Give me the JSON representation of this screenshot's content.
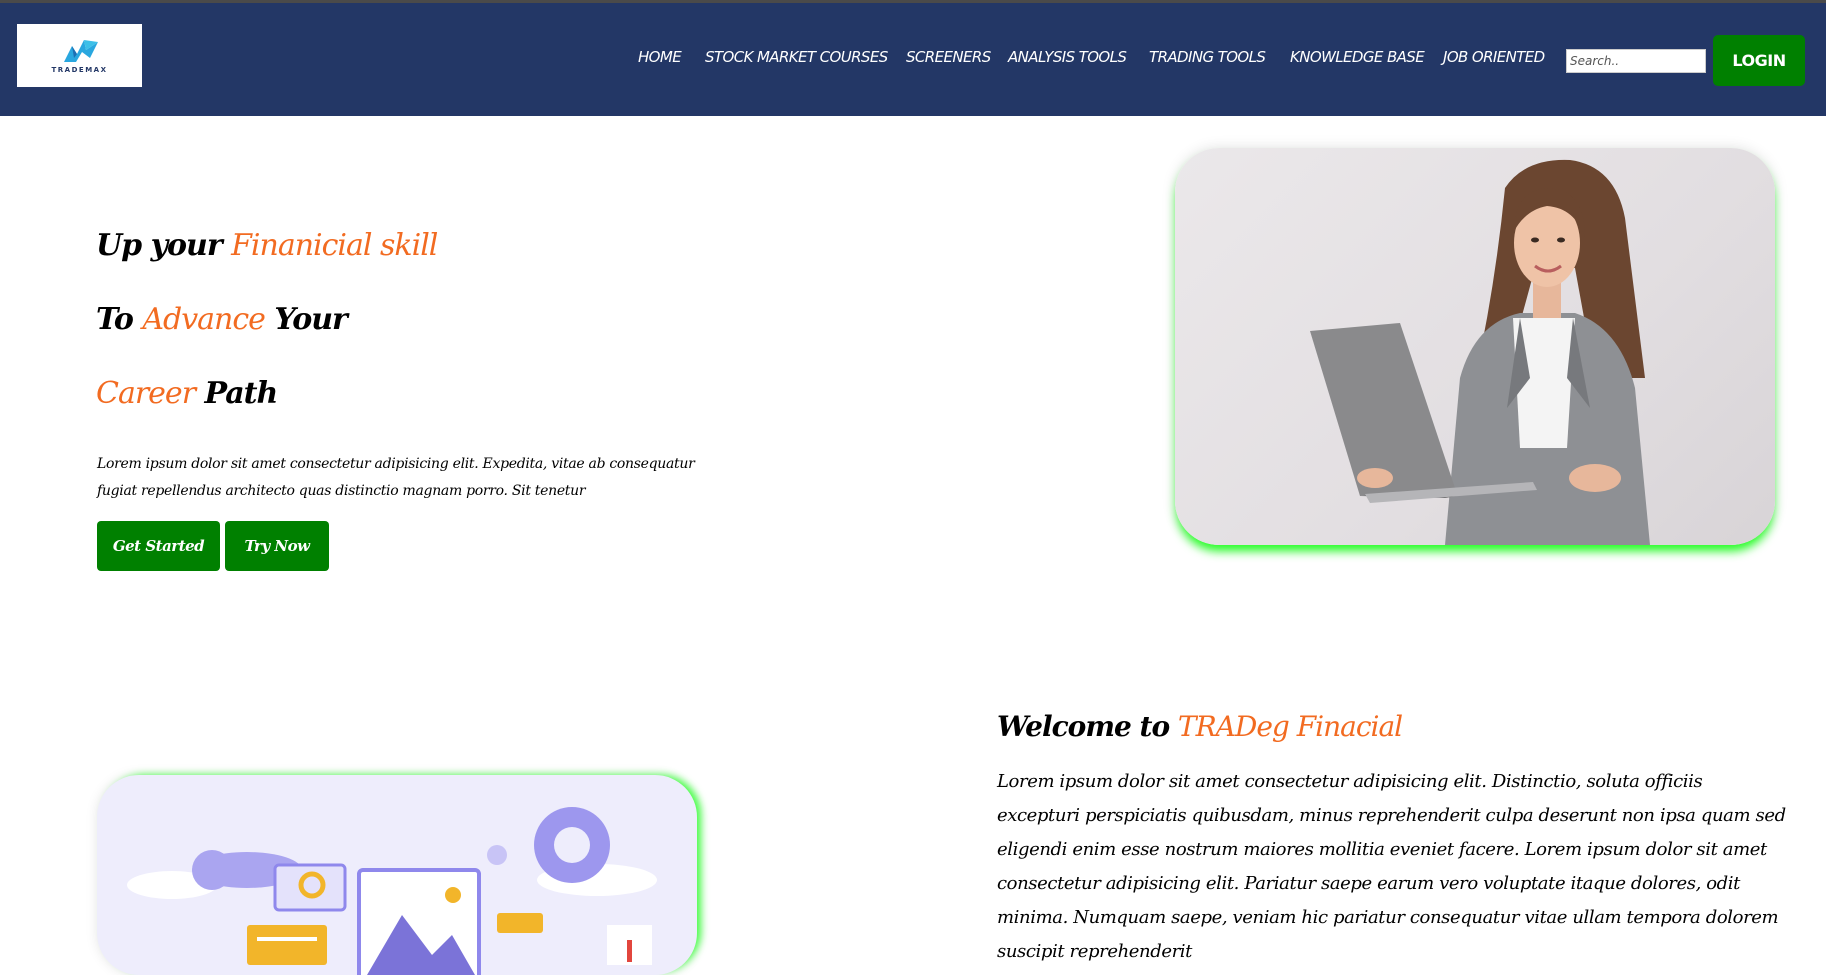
{
  "brand": {
    "logo_text": "TRADEMAX"
  },
  "nav": {
    "items": [
      "HOME",
      "STOCK MARKET COURSES",
      "SCREENERS",
      "ANALYSIS TOOLS",
      "TRADING TOOLS",
      "KNOWLEDGE BASE",
      "JOB ORIENTED"
    ],
    "search_placeholder": "Search..",
    "login_label": "LOGIN"
  },
  "hero": {
    "line1": {
      "a": "Up your ",
      "b": "Finanicial skill"
    },
    "line2": {
      "a": "To ",
      "b": "Advance",
      "c": " Your"
    },
    "line3": {
      "a": "Career",
      "b": " Path"
    },
    "text": "Lorem ipsum dolor sit amet consectetur adipisicing elit. Expedita, vitae ab consequatur fugiat repellendus architecto quas distinctio magnam porro. Sit tenetur",
    "btn_get_started": "Get Started",
    "btn_try_now": "Try Now"
  },
  "welcome": {
    "title_a": "Welcome to ",
    "title_b": "TRADeg Finacial",
    "text": "Lorem ipsum dolor sit amet consectetur adipisicing elit. Distinctio, soluta officiis excepturi perspiciatis quibusdam, minus reprehenderit culpa deserunt non ipsa quam sed eligendi enim esse nostrum maiores mollitia eveniet facere. Lorem ipsum dolor sit amet consectetur adipisicing elit. Pariatur saepe earum vero voluptate itaque dolores, odit minima. Numquam saepe, veniam hic pariatur consequatur vitae ullam tempora dolorem suscipit reprehenderit"
  },
  "colors": {
    "navbar": "#233766",
    "accent": "#f26b21",
    "button": "#008000",
    "glow": "#22ff22"
  }
}
